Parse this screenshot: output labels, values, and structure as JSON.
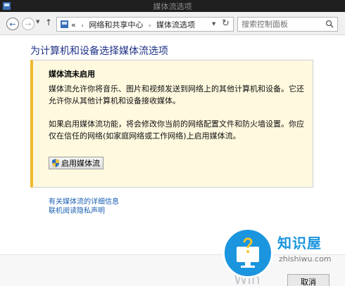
{
  "window": {
    "title": "媒体流选项"
  },
  "navigation": {
    "back_glyph": "←",
    "forward_glyph": "→",
    "up_glyph": "↑",
    "breadcrumb": [
      "«",
      "网络和共享中心",
      "媒体流选项"
    ],
    "refresh_glyph": "↻",
    "search_placeholder": "搜索控制面板"
  },
  "main": {
    "heading": "为计算机和设备选择媒体流选项",
    "info": {
      "title": "媒体流未启用",
      "para1": "媒体流允许你将音乐、图片和视频发送到网络上的其他计算机和设备。它还允许你从其他计算机和设备接收媒体。",
      "para2": "如果启用媒体流功能，将会修改你当前的网络配置文件和防火墙设置。你应仅在信任的网络(如家庭网络或工作网络)上启用媒体流。",
      "enable_button": "启用媒体流"
    },
    "links": [
      "有关媒体流的详细信息",
      "联机阅读隐私声明"
    ]
  },
  "footer": {
    "cancel_label": "取消",
    "windows_text": "Win"
  },
  "watermark": {
    "brand": "知识屋",
    "url": "zhishiwu.com"
  },
  "colors": {
    "heading": "#1e3287",
    "link": "#1a5fb4",
    "info_accent": "#f2b92b",
    "info_bg": "#fff9df"
  }
}
